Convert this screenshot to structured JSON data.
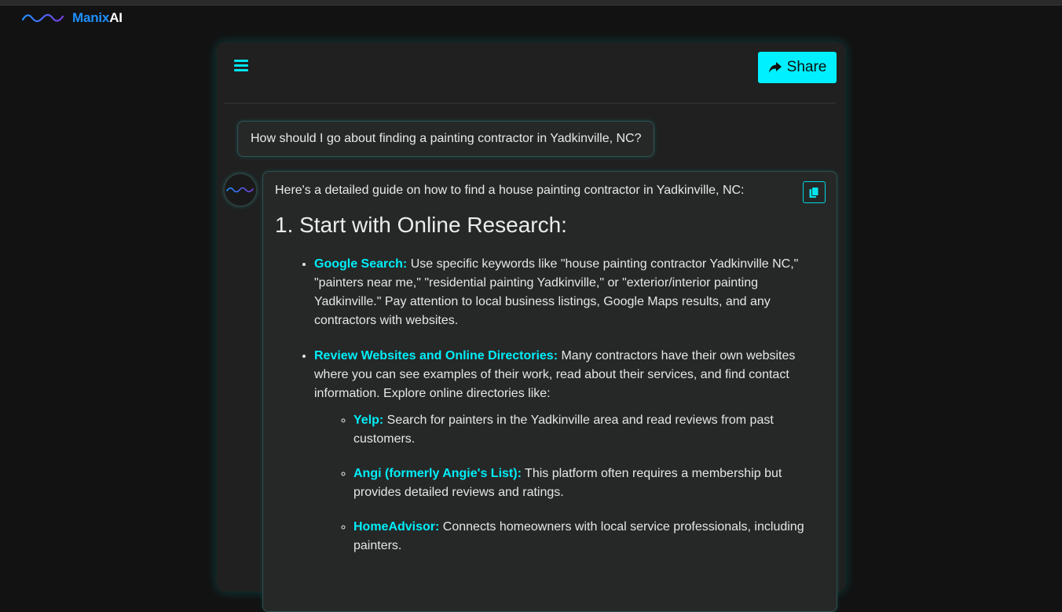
{
  "brand": {
    "name_part1": "Manix",
    "name_part2": "AI",
    "logo_icon": "wave-logo-icon"
  },
  "header": {
    "menu_icon": "hamburger-menu-icon",
    "share_label": "Share",
    "share_icon": "share-arrow-icon"
  },
  "colors": {
    "accent": "#00f0ff",
    "brand_blue": "#1e90ff",
    "background": "#121212",
    "panel": "#202020"
  },
  "conversation": {
    "user_message": "How should I go about finding a painting contractor in Yadkinville, NC?",
    "assistant": {
      "avatar_icon": "wave-avatar-icon",
      "copy_icon": "copy-icon",
      "intro": "Here's a detailed guide on how to find a house painting contractor in Yadkinville, NC:",
      "heading": "1. Start with Online Research:",
      "items": [
        {
          "title": "Google Search:",
          "text": " Use specific keywords like \"house painting contractor Yadkinville NC,\" \"painters near me,\" \"residential painting Yadkinville,\" or \"exterior/interior painting Yadkinville.\" Pay attention to local business listings, Google Maps results, and any contractors with websites."
        },
        {
          "title": "Review Websites and Online Directories:",
          "text": " Many contractors have their own websites where you can see examples of their work, read about their services, and find contact information. Explore online directories like:",
          "sub_items": [
            {
              "title": "Yelp:",
              "text": " Search for painters in the Yadkinville area and read reviews from past customers."
            },
            {
              "title": "Angi (formerly Angie's List):",
              "text": " This platform often requires a membership but provides detailed reviews and ratings."
            },
            {
              "title": "HomeAdvisor:",
              "text": " Connects homeowners with local service professionals, including painters."
            }
          ]
        }
      ]
    }
  }
}
